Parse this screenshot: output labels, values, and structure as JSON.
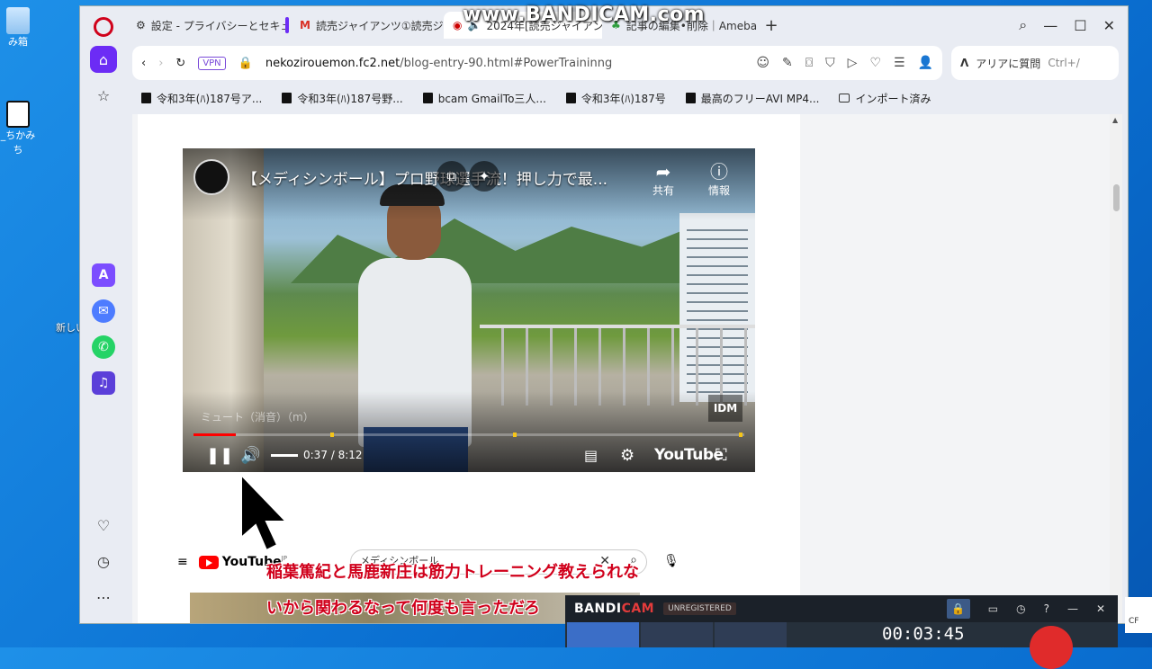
{
  "desktop": {
    "icons": [
      {
        "label": "み箱"
      },
      {
        "label": "_ちかみち"
      }
    ],
    "side_label": "新しい"
  },
  "watermark": "www.BANDICAM.com",
  "browser": {
    "tabs": [
      {
        "label": "設定 - プライバシーとセキュリテ"
      },
      {
        "label": "読売ジャイアンツ①読売ジャイ"
      },
      {
        "label": "2024年[読売ジャイアン"
      },
      {
        "label": "記事の編集•削除｜Ameba"
      }
    ],
    "address": {
      "vpn": "VPN",
      "host": "nekozirouemon.fc2.net",
      "path": "/blog-entry-90.html#PowerTraininng"
    },
    "aria": {
      "label": "アリアに質問",
      "shortcut": "Ctrl+/"
    },
    "bookmarks": [
      {
        "label": "令和3年(ﾊ)187号ア..."
      },
      {
        "label": "令和3年(ﾊ)187号野..."
      },
      {
        "label": "bcam GmailTo三人..."
      },
      {
        "label": "令和3年(ﾊ)187号"
      },
      {
        "label": "最高のフリーAVI MP4..."
      },
      {
        "label": "インポート済み"
      }
    ]
  },
  "video": {
    "title": "【メディシンボール】プロ野球選手流！押し力で最...",
    "share": "共有",
    "info": "情報",
    "tooltip": "ミュート（消音）（m）",
    "badge": "IDM",
    "time": "0:37 / 8:12",
    "progress": 0.076,
    "brand": "YouTube"
  },
  "youtube_strip": {
    "brand": "YouTube",
    "region": "JP",
    "search_value": "メディシンボール"
  },
  "subtitles": [
    "稲葉篤紀と馬鹿新庄は筋力トレーニング教えられな",
    "いから関わるなって何度も言っただろ"
  ],
  "bandicam": {
    "title_a": "BANDI",
    "title_b": "CAM",
    "unregistered": "UNREGISTERED",
    "timer": "00:03:45",
    "help": "?"
  },
  "tray": {
    "text": "CF"
  }
}
